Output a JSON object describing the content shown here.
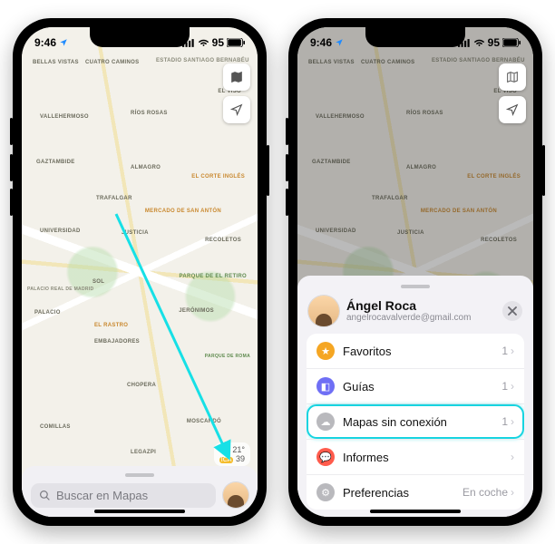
{
  "status": {
    "time": "9:46",
    "battery": "95"
  },
  "map_controls": {
    "mode_icon": "map-layers-icon",
    "locate_icon": "location-arrow-icon"
  },
  "weather": {
    "temp": "21°",
    "aqi_label": "ICA",
    "aqi_value": "39"
  },
  "search": {
    "placeholder": "Buscar en Mapas"
  },
  "map_labels": {
    "bellas_vistas": "BELLAS\nVISTAS",
    "cuatro_caminos": "CUATRO\nCAMINOS",
    "bernabeu": "ESTADIO\nSANTIAGO\nBERNABÉU",
    "el_viso": "EL VISO",
    "vallehermoso": "VALLEHERMOSO",
    "rios_rosas": "RÍOS ROSAS",
    "gaztambide": "GAZTAMBIDE",
    "almagro": "ALMAGRO",
    "corte_ingles": "El Corte Inglés",
    "trafalgar": "TRAFALGAR",
    "universidad": "UNIVERSIDAD",
    "mercado": "Mercado de\nSan Antón",
    "justicia": "JUSTICIA",
    "recoletos": "RECOLETOS",
    "sol": "SOL",
    "retiro": "PARQUE DE\nEL RETIRO",
    "palacio_real": "Palacio Real\nde Madrid",
    "palacio": "PALACIO",
    "el_rastro": "El Rastro",
    "embajadores": "EMBAJADORES",
    "jeronimos": "JERÓNIMOS",
    "chopera": "CHOPERA",
    "comillas": "COMILLAS",
    "moscardo": "MOSCARDÓ",
    "legazpi": "LEGAZPI",
    "parque_roma": "Parque\nde Roma"
  },
  "profile": {
    "name": "Ángel Roca",
    "email": "angelrocavalverde@gmail.com",
    "items": [
      {
        "icon": "star",
        "color": "#f5a623",
        "label": "Favoritos",
        "meta": "1"
      },
      {
        "icon": "guides",
        "color": "#6f6ff5",
        "label": "Guías",
        "meta": "1"
      },
      {
        "icon": "cloud",
        "color": "#b9b9bd",
        "label": "Mapas sin conexión",
        "meta": "1",
        "highlight": true
      },
      {
        "icon": "report",
        "color": "#ff5b4c",
        "label": "Informes",
        "meta": ""
      },
      {
        "icon": "gear",
        "color": "#b9b9bd",
        "label": "Preferencias",
        "meta": "En coche"
      }
    ]
  }
}
